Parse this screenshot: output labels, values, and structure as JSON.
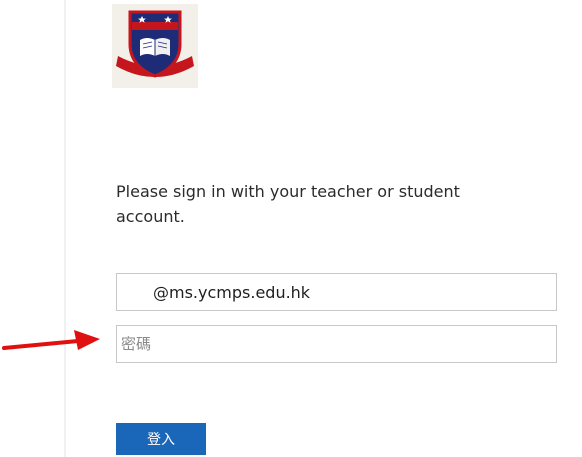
{
  "header": {
    "logo_icon": "school-crest-icon",
    "logo_colors": {
      "crest_blue": "#1e2c78",
      "crest_red": "#c4161c",
      "background": "#f3efe9"
    }
  },
  "signin": {
    "prompt": "Please sign in with your teacher or student account.",
    "email_value": "@ms.ycmps.edu.hk",
    "password_placeholder": "密碼",
    "submit_label": "登入",
    "submit_color": "#1a66b8"
  },
  "annotation": {
    "arrow_icon": "red-arrow-icon",
    "arrow_color": "#e01010"
  }
}
